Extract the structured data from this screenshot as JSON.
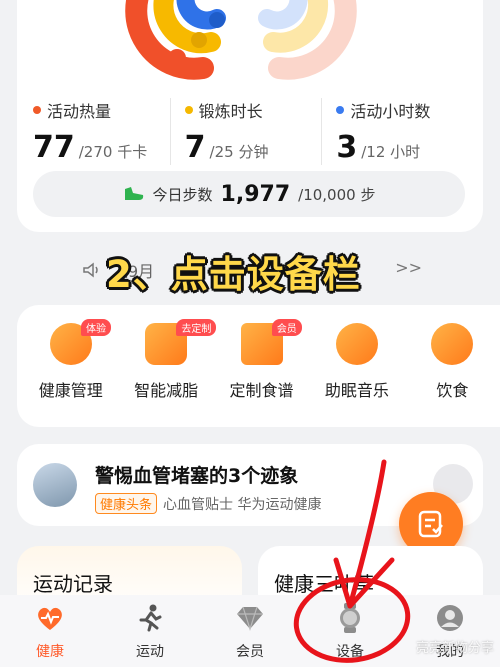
{
  "metrics": [
    {
      "label": "活动热量",
      "value": "77",
      "rest": "/270 千卡",
      "color": "#f05a28"
    },
    {
      "label": "锻炼时长",
      "value": "7",
      "rest": "/25 分钟",
      "color": "#f5b800"
    },
    {
      "label": "活动小时数",
      "value": "3",
      "rest": "/12 小时",
      "color": "#3a7bf0"
    }
  ],
  "steps": {
    "label": "今日步数",
    "value": "1,977",
    "goal": "/10,000 步"
  },
  "notice": {
    "text": "入9月",
    "arrows": ">>"
  },
  "overlay": {
    "text": "2、点击设备栏"
  },
  "services": [
    {
      "label": "健康管理",
      "badge": "体验",
      "icon": "health-manage-icon"
    },
    {
      "label": "智能减脂",
      "badge": "去定制",
      "icon": "fat-loss-icon"
    },
    {
      "label": "定制食谱",
      "badge": "会员",
      "icon": "recipe-book-icon"
    },
    {
      "label": "助眠音乐",
      "badge": "",
      "icon": "sleep-music-icon"
    },
    {
      "label": "饮食",
      "badge": "",
      "icon": "diet-bowl-icon"
    }
  ],
  "news": {
    "title": "警惕血管堵塞的3个迹象",
    "tag": "健康头条",
    "source": "心血管贴士 华为运动健康"
  },
  "cards": {
    "sport": "运动记录",
    "herb": "健康三叶草"
  },
  "tabs": [
    {
      "label": "健康",
      "icon": "heart-icon",
      "active": true
    },
    {
      "label": "运动",
      "icon": "running-icon",
      "active": false
    },
    {
      "label": "会员",
      "icon": "diamond-icon",
      "active": false
    },
    {
      "label": "设备",
      "icon": "watch-icon",
      "active": false
    },
    {
      "label": "我的",
      "icon": "profile-icon",
      "active": false
    }
  ],
  "watermark": "亮亮新物分享",
  "colors": {
    "accent": "#ff7d22",
    "annotation": "#e8141b",
    "overlay_text": "#ffd84a"
  }
}
